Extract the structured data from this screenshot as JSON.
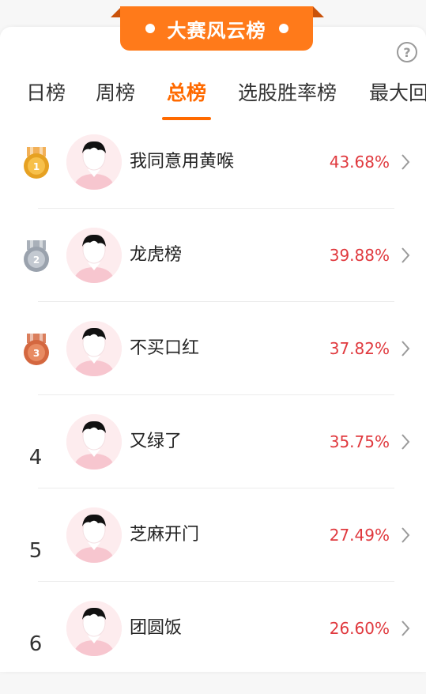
{
  "banner": {
    "title": "大赛风云榜"
  },
  "help": {
    "label": "?"
  },
  "tabs": [
    {
      "label": "日榜"
    },
    {
      "label": "周榜"
    },
    {
      "label": "总榜"
    },
    {
      "label": "选股胜率榜"
    },
    {
      "label": "最大回"
    }
  ],
  "active_tab": "总榜",
  "rankings": [
    {
      "rank": "1",
      "name": "我同意用黄喉",
      "rate": "43.68%"
    },
    {
      "rank": "2",
      "name": "龙虎榜",
      "rate": "39.88%"
    },
    {
      "rank": "3",
      "name": "不买口红",
      "rate": "37.82%"
    },
    {
      "rank": "4",
      "name": "又绿了",
      "rate": "35.75%"
    },
    {
      "rank": "5",
      "name": "芝麻开门",
      "rate": "27.49%"
    },
    {
      "rank": "6",
      "name": "团圆饭",
      "rate": "26.60%"
    }
  ],
  "colors": {
    "accent": "#ff6a00",
    "rate": "#e0393e",
    "gold": "#e6a122",
    "silver": "#9aa2ad",
    "bronze": "#d4673f"
  }
}
